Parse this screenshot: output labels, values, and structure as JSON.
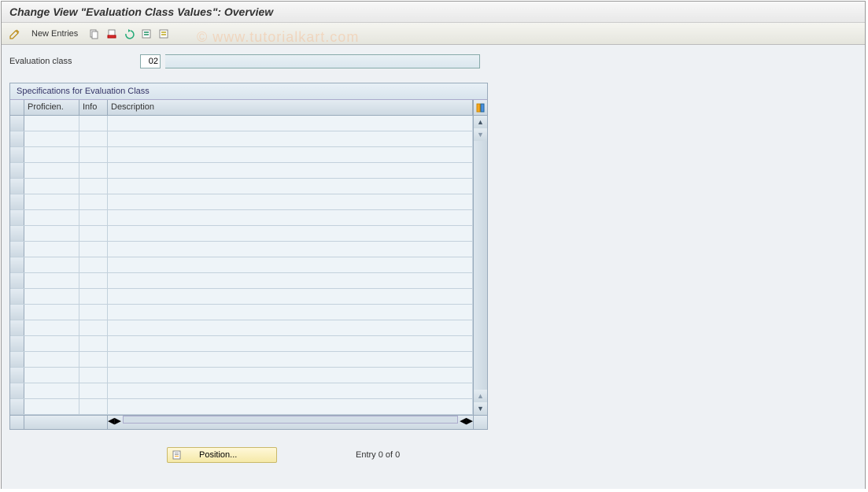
{
  "title": "Change View \"Evaluation Class Values\": Overview",
  "watermark": "© www.tutorialkart.com",
  "toolbar": {
    "new_entries": "New Entries"
  },
  "fields": {
    "eval_class_label": "Evaluation class",
    "eval_class_value": "02",
    "eval_class_desc": ""
  },
  "panel": {
    "title": "Specifications for Evaluation Class",
    "columns": {
      "proficiency": "Proficien.",
      "info": "Info",
      "description": "Description"
    },
    "row_count": 19
  },
  "footer": {
    "position_label": "Position...",
    "entry_text": "Entry 0 of 0"
  }
}
